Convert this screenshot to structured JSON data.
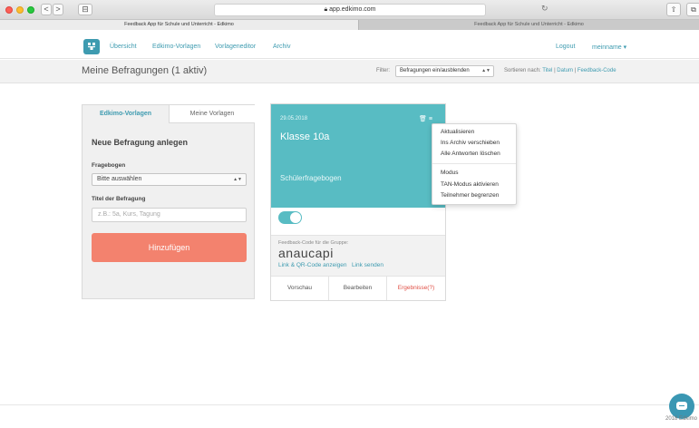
{
  "browser": {
    "url": "app.edkimo.com",
    "tabs": [
      "Feedback App für Schule und Unterricht - Edkimo",
      "Feedback App für Schule und Unterricht - Edkimo"
    ],
    "back_glyph": "<",
    "forward_glyph": ">",
    "sidebar_glyph": "⊟",
    "reload_glyph": "↻",
    "share_glyph": "⇧",
    "newtab_glyph": "⧉"
  },
  "nav": {
    "links": [
      "Übersicht",
      "Edkimo-Vorlagen",
      "Vorlageneditor",
      "Archiv"
    ],
    "logout": "Logout",
    "user": "meinname ▾"
  },
  "header": {
    "title": "Meine Befragungen (1 aktiv)",
    "filter_label": "Filter:",
    "filter_value": "Befragungen ein/ausblenden",
    "sort_label": "Sortieren nach:",
    "sort_options": [
      "Titel",
      "Datum",
      "Feedback-Code"
    ],
    "sort_separator": "|"
  },
  "create_panel": {
    "tabs": [
      "Edkimo-Vorlagen",
      "Meine Vorlagen"
    ],
    "heading": "Neue Befragung anlegen",
    "questionnaire_label": "Fragebogen",
    "questionnaire_value": "Bitte auswählen",
    "title_label": "Titel der Befragung",
    "title_placeholder": "z.B.: 5a, Kurs, Tagung",
    "add_button": "Hinzufügen"
  },
  "survey_card": {
    "date": "29.05.2018",
    "class_name": "Klasse 10a",
    "questionnaire": "Schülerfragebogen",
    "active": true,
    "code_label": "Feedback-Code für die Gruppe:",
    "code": "anaucapi",
    "link_qr": "Link & QR-Code anzeigen",
    "link_send": "Link senden",
    "footer": [
      "Vorschau",
      "Bearbeiten",
      "Ergebnisse(?)"
    ]
  },
  "card_menu": {
    "items": [
      "Aktualisieren",
      "Ins Archiv verschieben",
      "Alle Antworten löschen",
      "Modus",
      "TAN-Modus aktivieren",
      "Teilnehmer begrenzen"
    ]
  },
  "footer": {
    "text": "2018 Edkimo"
  },
  "colors": {
    "accent": "#3e9bb0",
    "card": "#58bcc3",
    "add_button": "#f3826e",
    "results": "#e04f45"
  }
}
